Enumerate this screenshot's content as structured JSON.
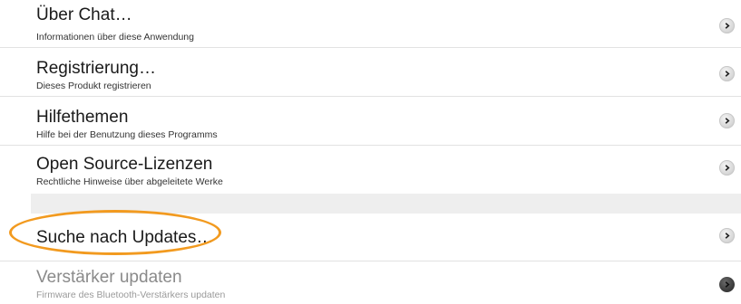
{
  "items": [
    {
      "title": "Über Chat…",
      "subtitle": "Informationen über diese Anwendung",
      "icon": "chevron-right-icon"
    },
    {
      "title": "Registrierung…",
      "subtitle": "Dieses Produkt registrieren",
      "icon": "chevron-right-icon"
    },
    {
      "title": "Hilfethemen",
      "subtitle": "Hilfe bei der Benutzung dieses Programms",
      "icon": "chevron-right-icon"
    },
    {
      "title": "Open Source-Lizenzen",
      "subtitle": "Rechtliche Hinweise über abgeleitete Werke",
      "icon": "chevron-right-icon"
    },
    {
      "title": "Suche nach Updates…",
      "icon": "chevron-right-icon"
    },
    {
      "title": "Verstärker updaten",
      "subtitle": "Firmware des Bluetooth-Verstärkers updaten",
      "icon": "chevron-right-icon",
      "disabled": true
    }
  ],
  "colors": {
    "highlight": "#f29a1f",
    "section_gap": "#eeeeee",
    "disabled_text": "#8a8a8a"
  }
}
